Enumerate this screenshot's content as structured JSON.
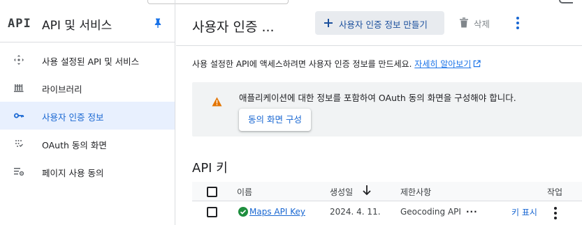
{
  "sidebar": {
    "logo": "API",
    "title": "API 및 서비스",
    "items": [
      {
        "label": "사용 설정된 API 및 서비스",
        "icon": "apis-services-icon",
        "active": false
      },
      {
        "label": "라이브러리",
        "icon": "library-icon",
        "active": false
      },
      {
        "label": "사용자 인증 정보",
        "icon": "key-icon",
        "active": true
      },
      {
        "label": "OAuth 동의 화면",
        "icon": "oauth-consent-icon",
        "active": false
      },
      {
        "label": "페이지 사용 동의",
        "icon": "page-usage-icon",
        "active": false
      }
    ]
  },
  "header": {
    "title": "사용자 인증 ...",
    "create_label": "사용자 인증 정보 만들기",
    "delete_label": "삭제"
  },
  "intro": {
    "text": "사용 설정한 API에 액세스하려면 사용자 인증 정보를 만드세요. ",
    "link": "자세히 알아보기"
  },
  "warning": {
    "message": "애플리케이션에 대한 정보를 포함하여 OAuth 동의 화면을 구성해야 합니다.",
    "button": "동의 화면 구성"
  },
  "api_keys": {
    "heading": "API 키",
    "columns": {
      "name": "이름",
      "created": "생성일",
      "restrictions": "제한사항",
      "actions": "작업"
    },
    "rows": [
      {
        "name": "Maps API Key",
        "created": "2024. 4. 11.",
        "restrictions": "Geocoding API",
        "show_key": "키 표시"
      }
    ]
  },
  "colors": {
    "accent": "#1967d2",
    "active_bg": "#e8f0fe",
    "warning": "#e37400",
    "success": "#1e8e3e"
  }
}
